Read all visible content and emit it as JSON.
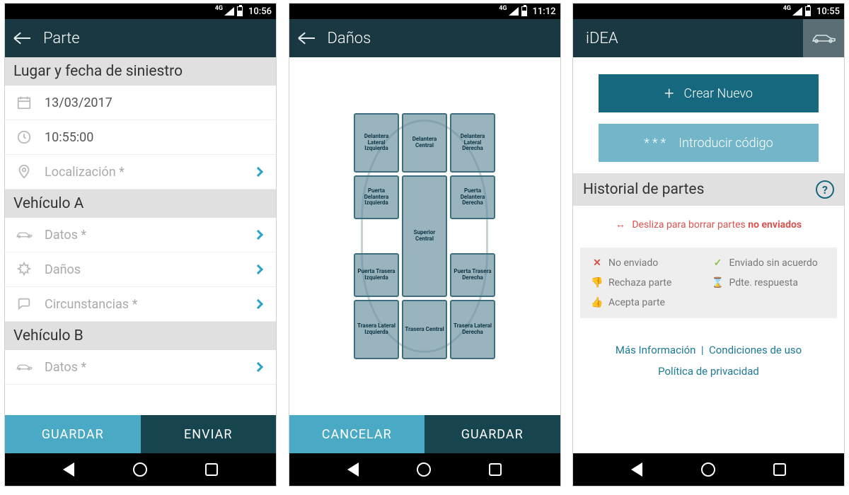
{
  "screen1": {
    "status_time": "10:56",
    "header": "Parte",
    "sections": {
      "lugar": {
        "title": "Lugar y fecha de siniestro",
        "date": "13/03/2017",
        "time": "10:55:00",
        "location": "Localización *"
      },
      "vehA": {
        "title": "Vehículo A",
        "datos": "Datos *",
        "danos": "Daños",
        "circ": "Circunstancias *"
      },
      "vehB": {
        "title": "Vehículo B",
        "datos": "Datos *"
      }
    },
    "footer": {
      "save": "GUARDAR",
      "send": "ENVIAR"
    }
  },
  "screen2": {
    "status_time": "11:12",
    "header": "Daños",
    "zones": {
      "fl": "Delantera Lateral Izquierda",
      "fc": "Delantera Central",
      "fr": "Delantera Lateral Derecha",
      "dfl": "Puerta Delantera Izquierda",
      "sc": "Superior Central",
      "dfr": "Puerta Delantera Derecha",
      "drl": "Puerta Trasera Izquierda",
      "drr": "Puerta Trasera Derecha",
      "rl": "Trasera Lateral Izquierda",
      "rc": "Trasera Central",
      "rr": "Trasera Lateral Derecha"
    },
    "footer": {
      "cancel": "CANCELAR",
      "save": "GUARDAR"
    }
  },
  "screen3": {
    "status_time": "10:55",
    "title": "iDEA",
    "btn_create": "Crear Nuevo",
    "btn_code": "Introducir código",
    "history_title": "Historial de partes",
    "swipe_hint_pre": "Desliza para borrar partes ",
    "swipe_hint_bold": "no enviados",
    "legend": {
      "no_enviado": "No enviado",
      "enviado": "Enviado sin acuerdo",
      "rechaza": "Rechaza parte",
      "pdte": "Pdte. respuesta",
      "acepta": "Acepta parte"
    },
    "links": {
      "more": "Más Información",
      "cond": "Condiciones de uso",
      "priv": "Política de privacidad"
    }
  }
}
